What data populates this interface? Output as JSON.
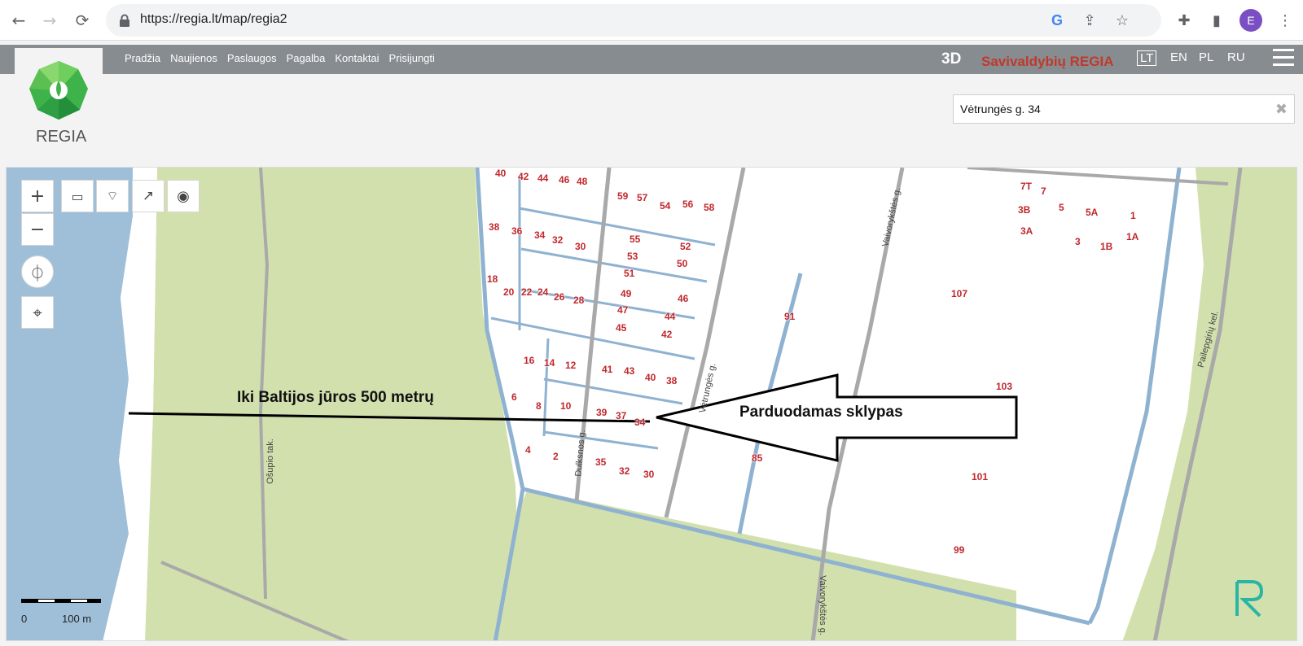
{
  "browser": {
    "url": "https://regia.lt/map/regia2",
    "profile_initial": "E"
  },
  "site": {
    "menu": [
      "Pradžia",
      "Naujienos",
      "Paslaugos",
      "Pagalba",
      "Kontaktai",
      "Prisijungti"
    ],
    "btn_3d": "3D",
    "brand": "Savivaldybių REGIA",
    "languages": [
      "LT",
      "EN",
      "PL",
      "RU"
    ],
    "active_language": "LT",
    "logo_text": "REGIA"
  },
  "search": {
    "value": "Vėtrungės g. 34"
  },
  "map": {
    "annotations": {
      "sea_label": "Iki Baltijos jūros  500 metrų",
      "plot_label": "Parduodamas sklypas"
    },
    "streets": [
      "Ošupio tak.",
      "Dulksnos g.",
      "Vėtrungės g.",
      "Vaivorykštės g.",
      "Vaivorykštės g.",
      "Pailepgirių kel."
    ],
    "scale": {
      "zero": "0",
      "distance": "100 m"
    },
    "plot_numbers": [
      "40",
      "42",
      "44",
      "46",
      "48",
      "59",
      "57",
      "54",
      "56",
      "58",
      "38",
      "36",
      "34",
      "32",
      "30",
      "55",
      "52",
      "53",
      "50",
      "51",
      "18",
      "20",
      "22",
      "24",
      "26",
      "28",
      "49",
      "46",
      "47",
      "44",
      "45",
      "42",
      "16",
      "14",
      "12",
      "41",
      "43",
      "40",
      "38",
      "6",
      "8",
      "10",
      "39",
      "37",
      "34",
      "4",
      "2",
      "35",
      "32",
      "30",
      "91",
      "85",
      "7T",
      "7",
      "3B",
      "5",
      "5A",
      "1",
      "3A",
      "3",
      "1B",
      "1A",
      "107",
      "103",
      "101",
      "99"
    ]
  },
  "colors": {
    "water": "#9fbfd9",
    "park": "#d2e0ad",
    "road": "#a9a9a9",
    "house_number": "#c0282d",
    "topbar": "#878c91"
  }
}
